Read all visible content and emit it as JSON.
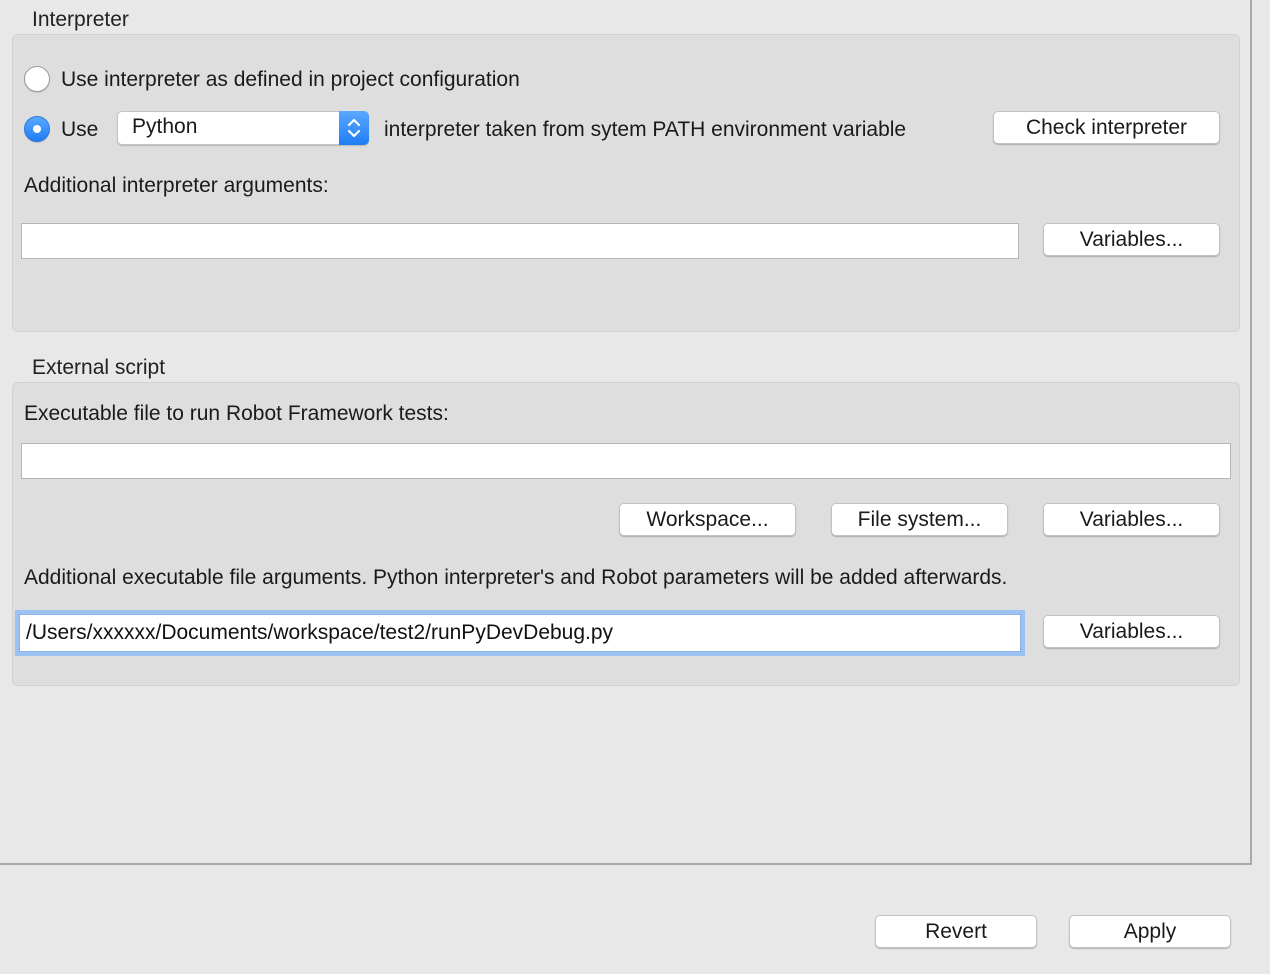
{
  "interpreter": {
    "title": "Interpreter",
    "radio_project_label": "Use interpreter as defined in project configuration",
    "radio_use_label": "Use",
    "interpreter_select_value": "Python",
    "from_path_text": "interpreter taken from sytem PATH environment variable",
    "check_button": "Check interpreter",
    "args_label": "Additional interpreter arguments:",
    "args_value": "",
    "variables_button": "Variables..."
  },
  "external_script": {
    "title": "External script",
    "executable_label": "Executable file to run Robot Framework tests:",
    "executable_value": "",
    "workspace_button": "Workspace...",
    "filesystem_button": "File system...",
    "variables_button": "Variables...",
    "args_label": "Additional executable file arguments. Python interpreter's and Robot parameters will be added afterwards.",
    "args_value": "/Users/xxxxxx/Documents/workspace/test2/runPyDevDebug.py",
    "args_variables_button": "Variables..."
  },
  "footer": {
    "revert_button": "Revert",
    "apply_button": "Apply"
  },
  "colors": {
    "accent": "#1f7ef5",
    "focus_ring": "#9cc2f2",
    "group_background": "#dedede",
    "window_background": "#e8e8e8"
  }
}
